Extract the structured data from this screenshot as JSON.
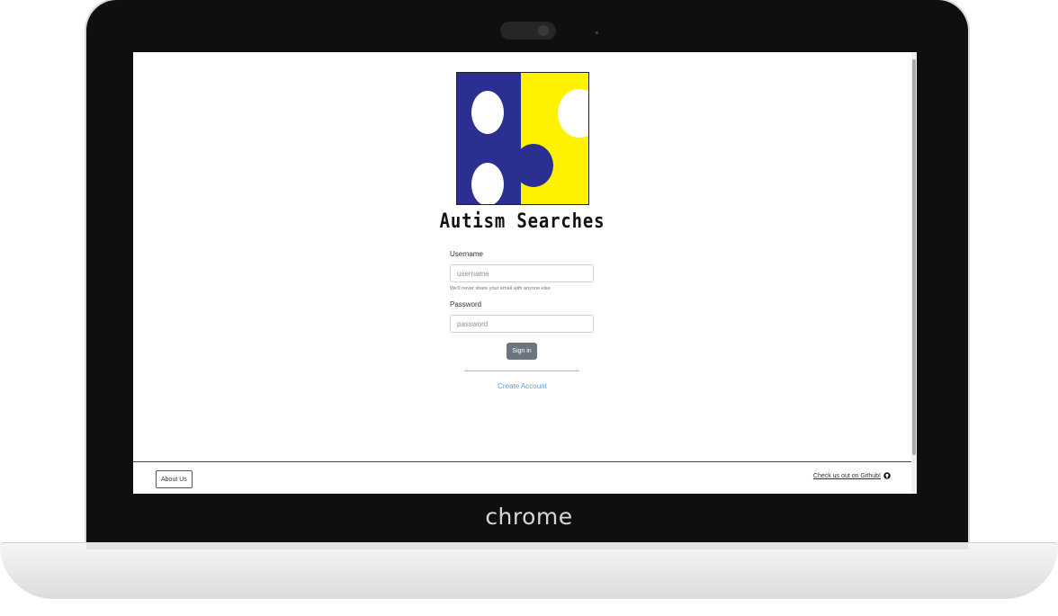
{
  "device": {
    "brand_label": "chrome"
  },
  "logo": {
    "title": "Autism Searches",
    "colors": {
      "left": "#2b2f8f",
      "right": "#fff200"
    }
  },
  "login_form": {
    "username_label": "Username",
    "username_placeholder": "username",
    "username_value": "",
    "help_text": "We'll never share your email with anyone else.",
    "password_label": "Password",
    "password_placeholder": "password",
    "password_value": "",
    "signin_label": "Sign in",
    "create_account_label": "Create Account"
  },
  "footer": {
    "about_label": "About Us",
    "github_text": "Check us out on Github!",
    "github_icon": "github-icon"
  },
  "colors": {
    "signin_button": "#6c757d",
    "link": "#5aa0e0"
  }
}
